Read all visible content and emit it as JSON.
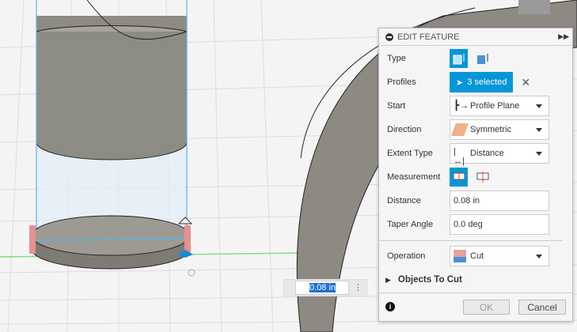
{
  "panel": {
    "title": "EDIT FEATURE",
    "labels": {
      "type": "Type",
      "profiles": "Profiles",
      "start": "Start",
      "direction": "Direction",
      "extent": "Extent Type",
      "measurement": "Measurement",
      "distance": "Distance",
      "taper": "Taper Angle",
      "operation": "Operation"
    },
    "profiles_value": "3 selected",
    "start_value": "Profile Plane",
    "direction_value": "Symmetric",
    "extent_value": "Distance",
    "distance_value": "0.08 in",
    "taper_value": "0.0 deg",
    "operation_value": "Cut",
    "objects_to_cut": "Objects To Cut",
    "ok": "OK",
    "cancel": "Cancel"
  },
  "viewport": {
    "dimension_input": "0.08 in"
  },
  "colors": {
    "accent": "#0696d7",
    "cut": "#e8a0a0"
  }
}
